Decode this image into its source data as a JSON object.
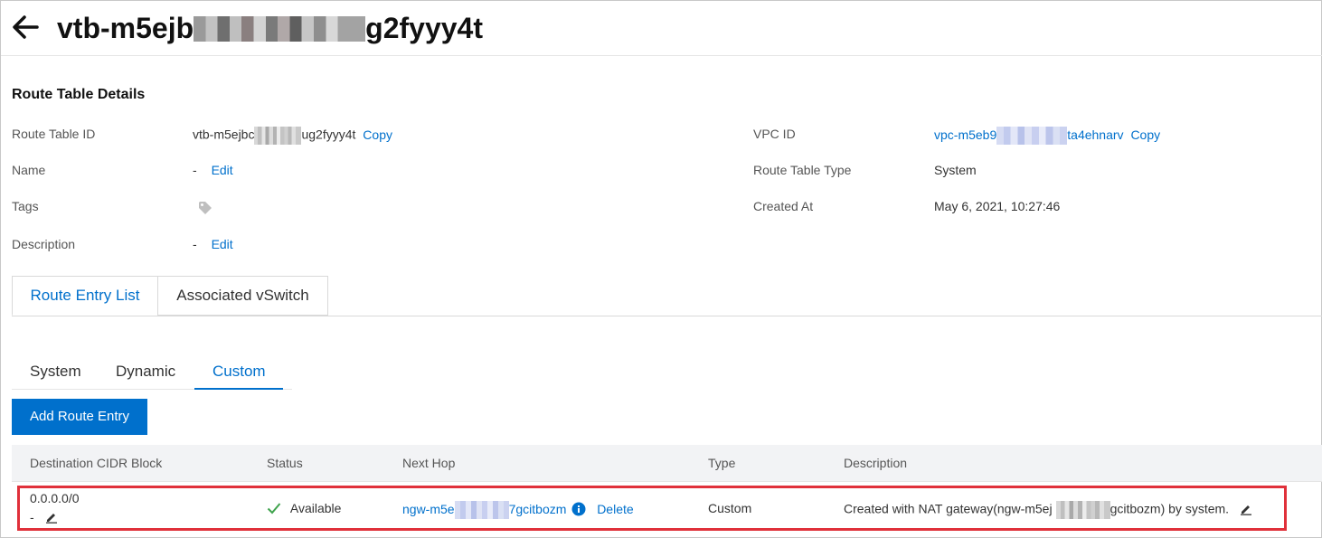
{
  "header": {
    "title_prefix": "vtb-m5ejb",
    "title_suffix": "g2fyyy4t"
  },
  "details": {
    "section_title": "Route Table Details",
    "route_table_id": {
      "label": "Route Table ID",
      "value_prefix": "vtb-m5ejbc",
      "value_suffix": "ug2fyyy4t",
      "copy": "Copy"
    },
    "name": {
      "label": "Name",
      "value": "-",
      "edit": "Edit"
    },
    "tags": {
      "label": "Tags"
    },
    "description": {
      "label": "Description",
      "value": "-",
      "edit": "Edit"
    },
    "vpc_id": {
      "label": "VPC ID",
      "value_prefix": "vpc-m5eb9",
      "value_suffix": "ta4ehnarv",
      "copy": "Copy"
    },
    "route_table_type": {
      "label": "Route Table Type",
      "value": "System"
    },
    "created_at": {
      "label": "Created At",
      "value": "May 6, 2021, 10:27:46"
    }
  },
  "tabs": [
    "Route Entry List",
    "Associated vSwitch"
  ],
  "subtabs": [
    "System",
    "Dynamic",
    "Custom"
  ],
  "add_button": "Add Route Entry",
  "table": {
    "columns": [
      "Destination CIDR Block",
      "Status",
      "Next Hop",
      "Type",
      "Description"
    ],
    "rows": [
      {
        "cidr": "0.0.0.0/0",
        "cidr_desc": "-",
        "status": "Available",
        "next_hop_prefix": "ngw-m5e",
        "next_hop_suffix": "7gcitbozm",
        "delete": "Delete",
        "type": "Custom",
        "description_prefix": "Created with NAT gateway(ngw-m5ej",
        "description_suffix": "gcitbozm) by system."
      }
    ]
  },
  "colors": {
    "accent": "#0070cc",
    "success": "#3fa34d",
    "highlight": "#e0303a"
  }
}
